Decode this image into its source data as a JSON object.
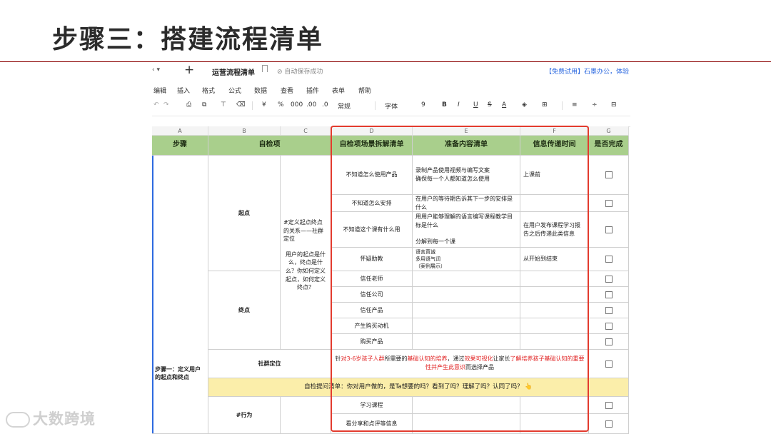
{
  "slide": {
    "title": "步骤三：搭建流程清单"
  },
  "app": {
    "doc_ctrl": "‹  ▾",
    "new_tab": "+",
    "doc_name": "运营流程清单",
    "save_status": "⊘ 自动保存成功",
    "trial_link": "【免费试用】石墨办公，体验",
    "menus": [
      "编辑",
      "插入",
      "格式",
      "公式",
      "数据",
      "查看",
      "插件",
      "表单",
      "帮助"
    ],
    "toolbar": {
      "undo": "↶",
      "redo": "↷",
      "print": "⎙",
      "copy_fmt": "⧉",
      "paint": "⊤",
      "clear": "⌫",
      "currency": "¥",
      "percent": "%",
      "thousands": "000",
      "dec_inc": ".00",
      "dec_dec": ".0",
      "number_format": "常规",
      "font": "字体",
      "font_size": "9",
      "bold": "B",
      "italic": "I",
      "underline": "U",
      "strike": "S",
      "text_color": "A",
      "fill": "◈",
      "border": "⊞",
      "align": "≡",
      "valign": "÷",
      "more": "⊟"
    }
  },
  "sheet": {
    "columns": [
      "A",
      "B",
      "C",
      "D",
      "E",
      "F",
      "G"
    ],
    "headers": {
      "a": "步骤",
      "bc": "自检项",
      "d": "自检项场景拆解清单",
      "e": "准备内容清单",
      "f": "信息传递时间",
      "g": "是否完成"
    },
    "a_step1": "步骤一：定义用户的起点和终点",
    "b_start": "起点",
    "b_end": "终点",
    "b_community": "社群定位",
    "b_action": "#行为",
    "c_def_title": "#定义起点终点的关系——社群定位",
    "c_def_body": "用户的起点是什么，终点是什么？你如何定义起点，如何定义终点？",
    "rows": [
      {
        "d": "不知道怎么使用产品",
        "e": "录制产品使用视频与编写文案\n确保每一个人都知道怎么使用",
        "f": "上课前"
      },
      {
        "d": "不知道怎么安排",
        "e": "在用户的等待期告诉其下一步的安排是什么",
        "f": ""
      },
      {
        "d": "不知道这个课有什么用",
        "e": "用用户能够理解的语言编写课程教学目标是什么\n\n分解到每一个课",
        "f": "在用户发布课程学习报告之后传递此类信息"
      },
      {
        "d": "怀疑助教",
        "e": "语言真诚\n多用语气词\n（案例展示）",
        "f": "从开始到结束"
      },
      {
        "d": "信任老师",
        "e": "",
        "f": ""
      },
      {
        "d": "信任公司",
        "e": "",
        "f": ""
      },
      {
        "d": "信任产品",
        "e": "",
        "f": ""
      },
      {
        "d": "产生购买动机",
        "e": "",
        "f": ""
      },
      {
        "d": "购买产品",
        "e": "",
        "f": ""
      }
    ],
    "community_text": {
      "p1": "针",
      "p2": "对3-6岁孩子人群",
      "p3": "所需要的",
      "p4": "基础认知的培养",
      "p5": "，通过",
      "p6": "效果可视化",
      "p7": "让家长",
      "p8": "了解培养孩子基础认知的重要性并产生此意识",
      "p9": "而选择产品"
    },
    "self_check_prompt": "自检提问清单：你对用户做的，是Ta想要的吗？看到了吗？理解了吗？认同了吗？ 👆",
    "action_rows": [
      {
        "d": "学习课程"
      },
      {
        "d": "看分享和点评等信息"
      }
    ]
  },
  "watermark": {
    "text": "大数跨境"
  },
  "colors": {
    "header_green": "#a9cf8c",
    "prompt_yellow": "#fbeeaa",
    "highlight_red": "#e33b2e",
    "link_blue": "#2d6ae0"
  }
}
